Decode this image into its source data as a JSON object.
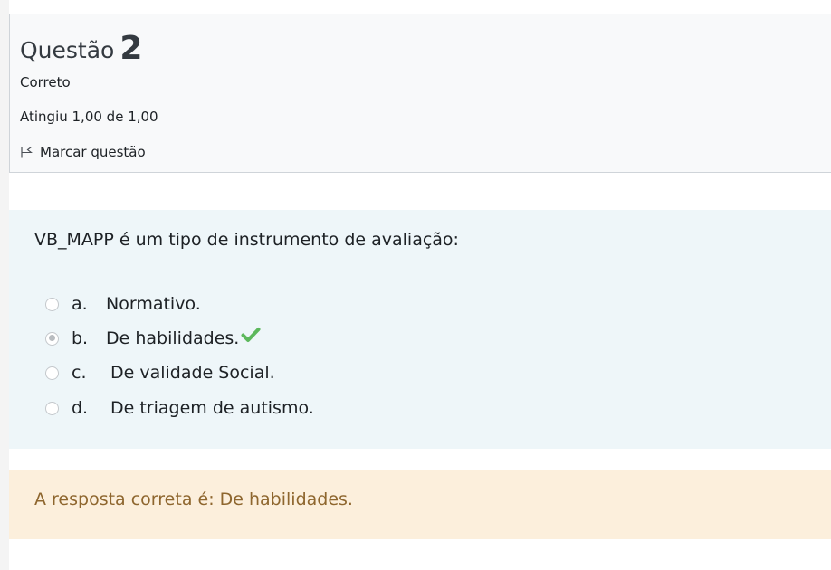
{
  "question_info": {
    "title_label": "Questão",
    "number": "2",
    "state": "Correto",
    "grade": "Atingiu 1,00 de 1,00",
    "flag_label": "Marcar questão"
  },
  "question": {
    "text": "VB_MAPP é um tipo de instrumento de avaliação:",
    "answers": [
      {
        "letter": "a.",
        "text": "Normativo.",
        "checked": false
      },
      {
        "letter": "b.",
        "text": "De habilidades.",
        "checked": true,
        "correct": true
      },
      {
        "letter": "c.",
        "text": "De validade Social.",
        "checked": false
      },
      {
        "letter": "d.",
        "text": "De triagem de autismo.",
        "checked": false
      }
    ]
  },
  "feedback": {
    "right_answer": "A resposta correta é: De habilidades."
  },
  "colors": {
    "info_bg": "#f8f9fa",
    "question_bg": "#eef6f9",
    "feedback_bg": "#fcefdc",
    "feedback_text": "#8e662e",
    "check_green": "#5cb85c"
  },
  "icons": {
    "flag": "flag-outline-icon",
    "correct": "checkmark-icon"
  }
}
